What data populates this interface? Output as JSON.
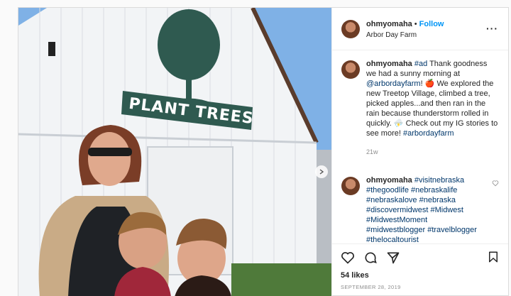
{
  "post": {
    "username": "ohmyomaha",
    "follow_label": "Follow",
    "location": "Arbor Day Farm",
    "sign_text": "PLANT TREES"
  },
  "caption": {
    "username": "ohmyomaha",
    "part1": "#ad",
    "part2": " Thank goodness we had a sunny morning at ",
    "mention": "@arbordayfarm",
    "part3": "! 🍎 We explored the new Treetop Village, climbed a tree, picked apples...and then ran in the rain because thunderstorm rolled in quickly. ⛈️ Check out my IG stories to see more! ",
    "tag": "#arbordayfarm",
    "time": "21w"
  },
  "comment": {
    "username": "ohmyomaha",
    "tags_line1": "#visitnebraska",
    "tags": "#thegoodlife #nebraskalife #nebraskalove #nebraska #discovermidwest #Midwest #MidwestMoment #midwestblogger #travelblogger #thelocaltourist #itsamazingoutthere #exploreamerica"
  },
  "footer": {
    "likes": "54 likes",
    "date": "SEPTEMBER 28, 2019"
  },
  "icons": [
    "heart-icon",
    "comment-icon",
    "share-icon",
    "bookmark-icon",
    "more-icon",
    "chevron-right-icon"
  ]
}
